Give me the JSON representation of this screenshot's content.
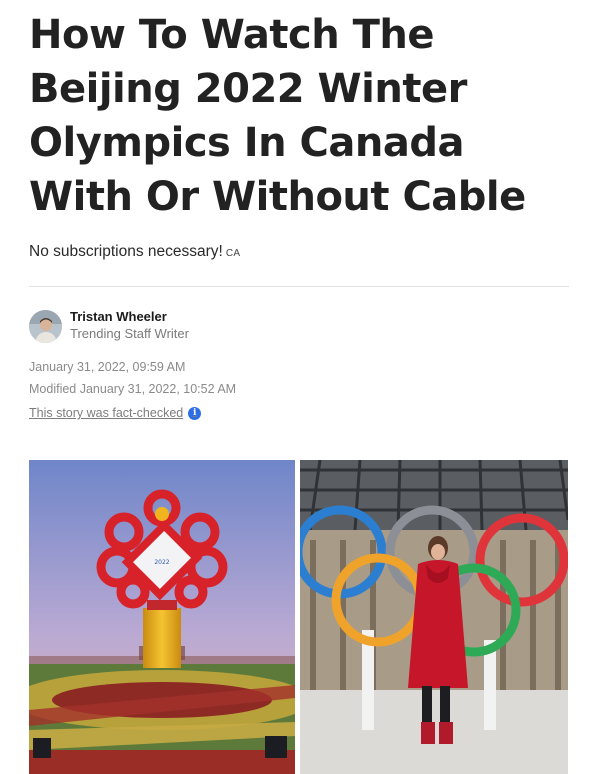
{
  "article": {
    "headline": "How To Watch The Beijing 2022 Winter Olympics In Canada With Or Without Cable",
    "dek": "No subscriptions necessary!",
    "region": "CA"
  },
  "author": {
    "name": "Tristan Wheeler",
    "role": "Trending Staff Writer"
  },
  "meta": {
    "published": "January 31, 2022, 09:59 AM",
    "modified": "Modified January 31, 2022, 10:52 AM",
    "fact_check": "This story was fact-checked",
    "fact_check_icon": "info-icon"
  },
  "colors": {
    "link_icon": "#2f6fe4",
    "headline": "#222222"
  },
  "images": [
    {
      "icon": "beijing-chinese-knot-monument-photo"
    },
    {
      "icon": "woman-in-red-coat-olympic-rings-photo"
    }
  ]
}
